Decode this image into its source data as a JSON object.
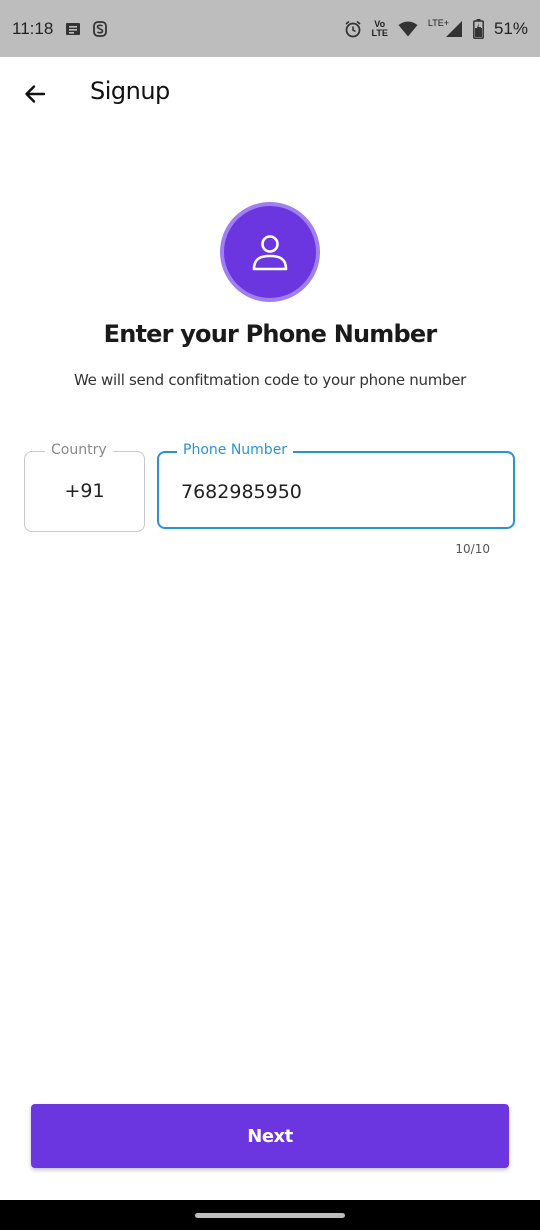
{
  "status_bar": {
    "time": "11:18",
    "battery": "51%",
    "icons": [
      "notification-icon",
      "s-app-icon",
      "alarm-icon",
      "volte-icon",
      "wifi-icon",
      "lte-signal-icon",
      "battery-icon"
    ],
    "vo_lte_top": "Vo",
    "vo_lte_bottom": "LTE",
    "lte_label": "LTE+"
  },
  "app_bar": {
    "title": "Signup"
  },
  "main": {
    "heading": "Enter your Phone Number",
    "subheading": "We will send confitmation code to your phone number",
    "country": {
      "label": "Country",
      "value": "+91"
    },
    "phone": {
      "label": "Phone Number",
      "value": "7682985950",
      "counter": "10/10"
    },
    "next_label": "Next"
  },
  "colors": {
    "accent": "#6b35e0",
    "focus": "#2a93d5"
  }
}
